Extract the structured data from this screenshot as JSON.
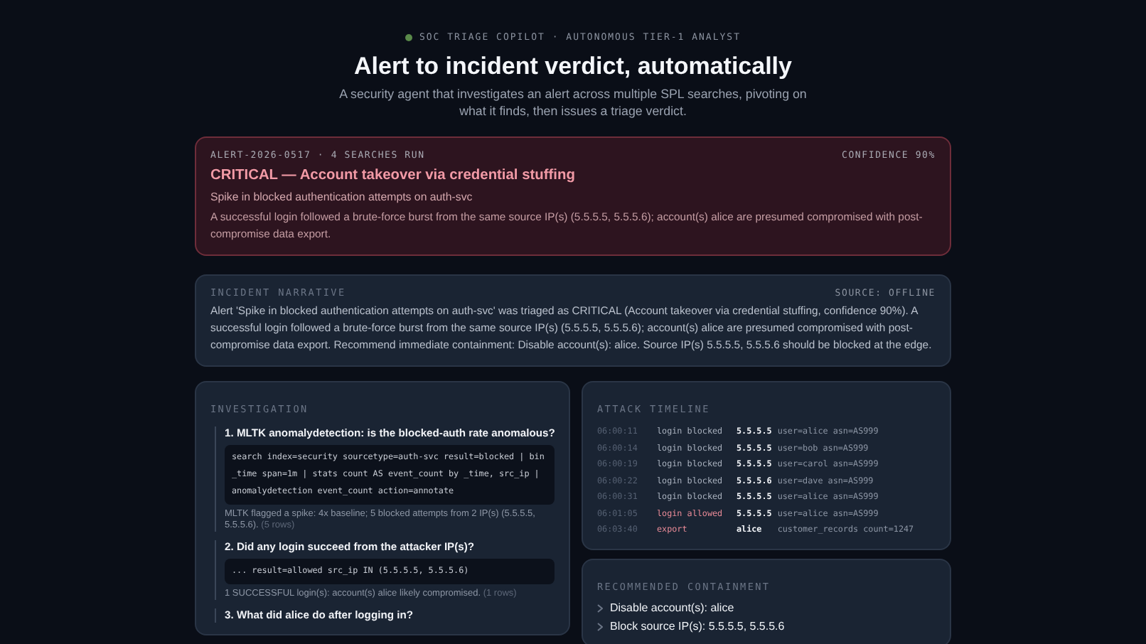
{
  "header": {
    "eyebrow": "SOC TRIAGE COPILOT · AUTONOMOUS TIER-1 ANALYST",
    "title": "Alert to incident verdict, automatically",
    "subtitle": "A security agent that investigates an alert across multiple SPL searches, pivoting on what it finds, then issues a triage verdict."
  },
  "alert": {
    "meta": "ALERT-2026-0517 · 4 SEARCHES RUN",
    "confidence": "CONFIDENCE 90%",
    "verdict": "CRITICAL — Account takeover via credential stuffing",
    "name": "Spike in blocked authentication attempts on auth-svc",
    "summary": "A successful login followed a brute-force burst from the same source IP(s) (5.5.5.5, 5.5.5.6); account(s) alice are presumed compromised with post-compromise data export."
  },
  "narrative": {
    "title": "INCIDENT NARRATIVE",
    "source": "SOURCE: OFFLINE",
    "text": "Alert 'Spike in blocked authentication attempts on auth-svc' was triaged as CRITICAL (Account takeover via credential stuffing, confidence 90%). A successful login followed a brute-force burst from the same source IP(s) (5.5.5.5, 5.5.5.6); account(s) alice are presumed compromised with post-compromise data export. Recommend immediate containment: Disable account(s): alice. Source IP(s) 5.5.5.5, 5.5.5.6 should be blocked at the edge."
  },
  "investigation": {
    "title": "INVESTIGATION",
    "steps": [
      {
        "question": "1. MLTK anomalydetection: is the blocked-auth rate anomalous?",
        "query": "search index=security sourcetype=auth-svc result=blocked | bin _time span=1m | stats count AS event_count by _time, src_ip | anomalydetection event_count action=annotate",
        "finding": "MLTK flagged a spike: 4x baseline; 5 blocked attempts from 2 IP(s) (5.5.5.5, 5.5.5.6).",
        "rows": "(5 rows)"
      },
      {
        "question": "2. Did any login succeed from the attacker IP(s)?",
        "query": "... result=allowed src_ip IN (5.5.5.5, 5.5.5.6)",
        "finding": "1 SUCCESSFUL login(s): account(s) alice likely compromised.",
        "rows": "(1 rows)"
      },
      {
        "question": "3. What did alice do after logging in?"
      }
    ]
  },
  "timeline": {
    "title": "ATTACK TIMELINE",
    "events": [
      {
        "time": "06:00:11",
        "action": "login blocked",
        "kind": "blocked",
        "subject": "5.5.5.5",
        "detail": "user=alice asn=AS999"
      },
      {
        "time": "06:00:14",
        "action": "login blocked",
        "kind": "blocked",
        "subject": "5.5.5.5",
        "detail": "user=bob asn=AS999"
      },
      {
        "time": "06:00:19",
        "action": "login blocked",
        "kind": "blocked",
        "subject": "5.5.5.5",
        "detail": "user=carol asn=AS999"
      },
      {
        "time": "06:00:22",
        "action": "login blocked",
        "kind": "blocked",
        "subject": "5.5.5.6",
        "detail": "user=dave asn=AS999"
      },
      {
        "time": "06:00:31",
        "action": "login blocked",
        "kind": "blocked",
        "subject": "5.5.5.5",
        "detail": "user=alice asn=AS999"
      },
      {
        "time": "06:01:05",
        "action": "login allowed",
        "kind": "allowed",
        "subject": "5.5.5.5",
        "detail": "user=alice asn=AS999"
      },
      {
        "time": "06:03:40",
        "action": "export",
        "kind": "export",
        "subject": "alice",
        "detail": "customer_records count=1247"
      }
    ]
  },
  "containment": {
    "title": "RECOMMENDED CONTAINMENT",
    "actions": [
      "Disable account(s): alice",
      "Block source IP(s): 5.5.5.5, 5.5.5.6"
    ]
  }
}
